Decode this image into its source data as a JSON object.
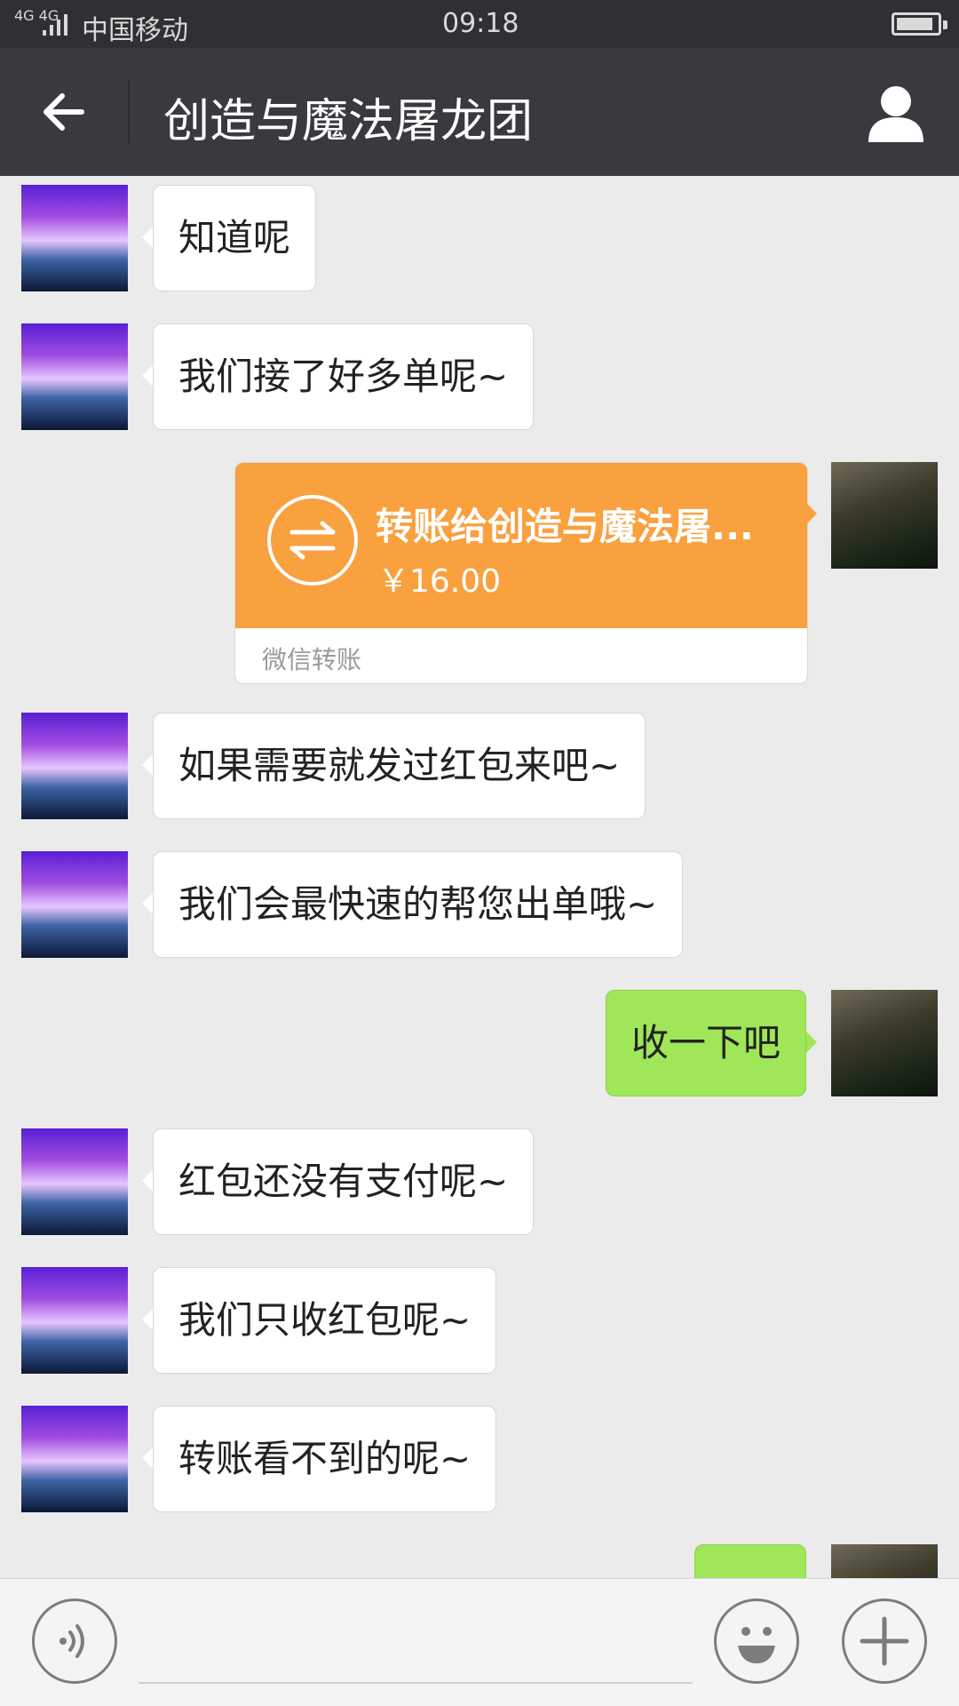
{
  "status_bar": {
    "signal": "4G 4G",
    "carrier": "中国移动",
    "time": "09:18"
  },
  "header": {
    "title": "创造与魔法屠龙团"
  },
  "messages": [
    {
      "side": "left",
      "text": "知道呢"
    },
    {
      "side": "left",
      "text": "我们接了好多单呢~"
    },
    {
      "side": "right",
      "type": "transfer",
      "title": "转账给创造与魔法屠...",
      "amount": "￥16.00",
      "footer": "微信转账"
    },
    {
      "side": "left",
      "text": "如果需要就发过红包来吧~"
    },
    {
      "side": "left",
      "text": "我们会最快速的帮您出单哦~"
    },
    {
      "side": "right",
      "text": "收一下吧"
    },
    {
      "side": "left",
      "text": "红包还没有支付呢~"
    },
    {
      "side": "left",
      "text": "我们只收红包呢~"
    },
    {
      "side": "left",
      "text": "转账看不到的呢~"
    },
    {
      "side": "right",
      "text": ""
    }
  ],
  "colors": {
    "header_bg": "#393a3f",
    "chat_bg": "#ebebeb",
    "green_bubble": "#9fe658",
    "transfer_orange": "#f9a03f"
  },
  "icons": {
    "back": "arrow-left-icon",
    "profile": "person-icon",
    "voice": "voice-icon",
    "emoji": "smiley-icon",
    "more": "plus-icon",
    "transfer": "transfer-arrows-icon"
  }
}
